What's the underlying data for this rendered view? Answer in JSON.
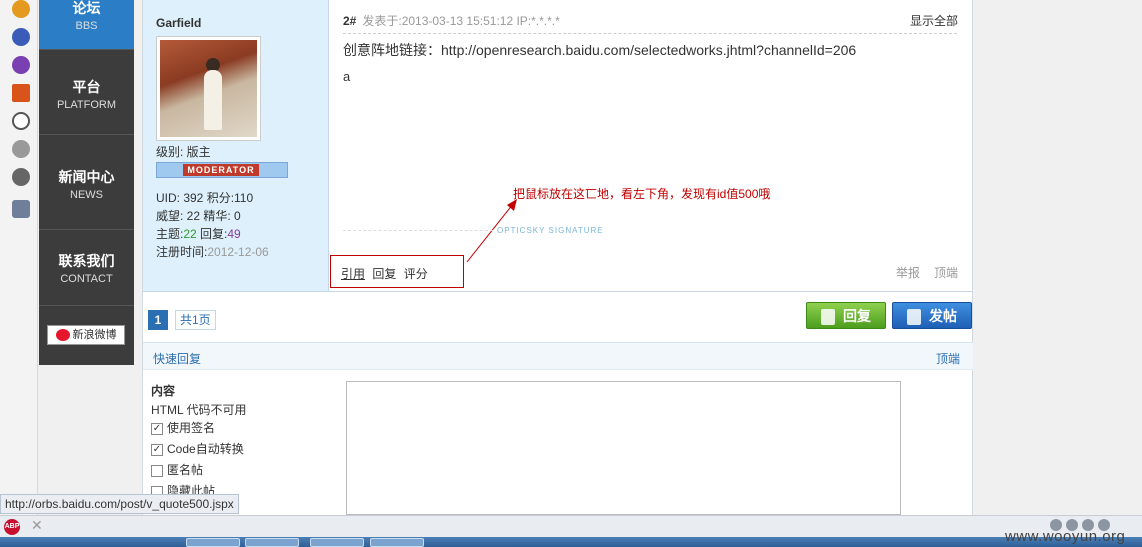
{
  "nav": {
    "items": [
      {
        "zh": "论坛",
        "en": "BBS"
      },
      {
        "zh": "平台",
        "en": "PLATFORM"
      },
      {
        "zh": "新闻中心",
        "en": "NEWS"
      },
      {
        "zh": "联系我们",
        "en": "CONTACT"
      }
    ],
    "weibo": "新浪微博"
  },
  "post": {
    "author": "Garfield",
    "level": "级别: 版主",
    "badge": "MODERATOR",
    "uid_score": "UID: 392 积分:110",
    "prestige": "威望: 22 精华: 0",
    "topics_label": "主题:",
    "topics": "22",
    "replies_label": " 回复:",
    "replies": "49",
    "reg_label": "注册时间:",
    "reg_date": "2012-12-06",
    "floor": "2#",
    "posted": "发表于:2013-03-13 15:51:12  IP:*.*.*.*",
    "show_all": "显示全部",
    "body_line1": "创意阵地链接：http://openresearch.baidu.com/selectedworks.jhtml?channelId=206",
    "body_line2": "a",
    "annotation": "把鼠标放在这匸地，看左下角，发现有id值500哦",
    "signature": "OPTICSKY SIGNATURE",
    "actions": {
      "quote": "引用",
      "reply": "回复",
      "rate": "评分"
    },
    "report": "举报",
    "top": "顶端"
  },
  "pager": {
    "current": "1",
    "total": "共1页"
  },
  "buttons": {
    "reply": "回复",
    "post": "发帖"
  },
  "quick_reply": {
    "title": "快速回复",
    "top": "顶端",
    "content_label": "内容",
    "html_note": "HTML 代码不可用",
    "options": [
      {
        "label": "使用签名",
        "checked": true
      },
      {
        "label": "Code自动转换",
        "checked": true
      },
      {
        "label": "匿名帖",
        "checked": false
      },
      {
        "label": "隐藏此帖",
        "checked": false
      }
    ]
  },
  "status_url": "http://orbs.baidu.com/post/v_quote500.jspx",
  "watermark": "www.wooyun.org",
  "colors": {
    "nav_active": "#2b7ec6",
    "author_bg": "#ddf0fb",
    "annotation": "#c00000",
    "reply_btn": "#4c9d1e",
    "post_btn": "#1e5fb5"
  }
}
